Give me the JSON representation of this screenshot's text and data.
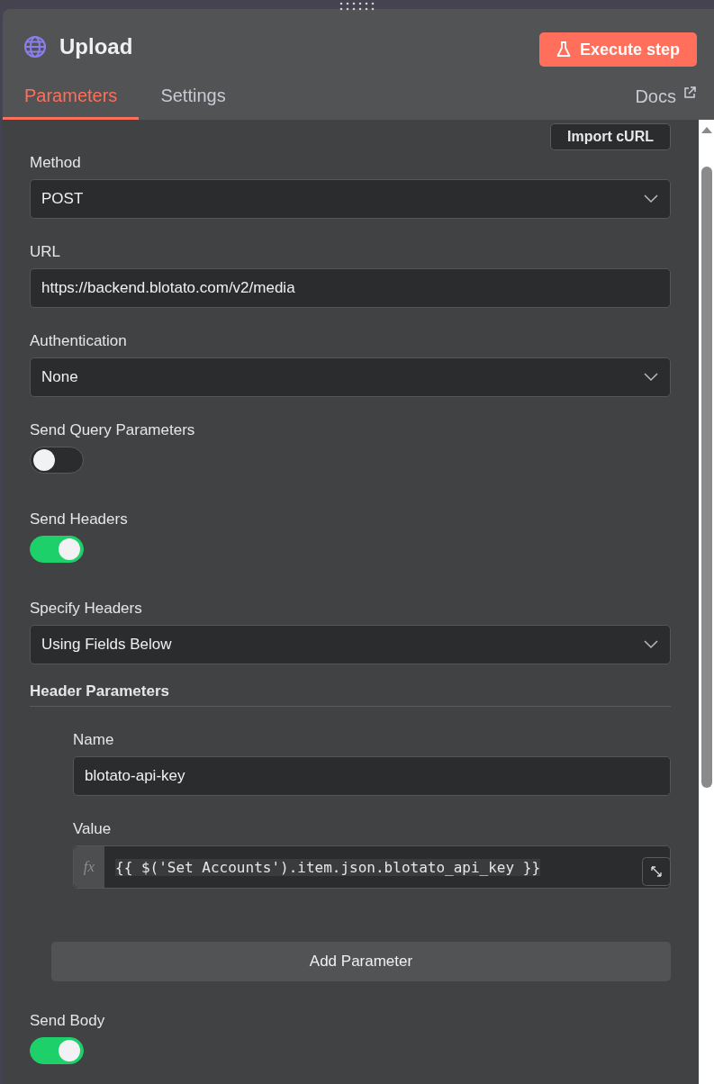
{
  "window": {
    "title": "Upload"
  },
  "execute_button": "Execute step",
  "tabs": [
    {
      "label": "Parameters",
      "selected": true
    },
    {
      "label": "Settings",
      "selected": false
    }
  ],
  "docs_link": "Docs",
  "import_button": "Import cURL",
  "fields": [
    {
      "kind": "select",
      "label": "Method",
      "value": "POST"
    },
    {
      "kind": "input",
      "label": "URL",
      "value": "https://backend.blotato.com/v2/media"
    },
    {
      "kind": "select",
      "label": "Authentication",
      "value": "None"
    },
    {
      "kind": "toggle",
      "label": "Send Query Parameters",
      "on": false
    },
    {
      "kind": "toggle",
      "label": "Send Headers",
      "on": true
    },
    {
      "kind": "select",
      "label": "Specify Headers",
      "value": "Using Fields Below"
    }
  ],
  "header_parameters": {
    "title": "Header Parameters",
    "items": [
      {
        "kind": "input",
        "label": "Name",
        "value": "blotato-api-key"
      },
      {
        "kind": "expression",
        "label": "Value",
        "prefix": "fx",
        "value": "{{ $('Set Accounts').item.json.blotato_api_key }}"
      }
    ]
  },
  "add_button": "Add Parameter",
  "after_fields": [
    {
      "kind": "toggle",
      "label": "Send Body",
      "on": true
    }
  ]
}
